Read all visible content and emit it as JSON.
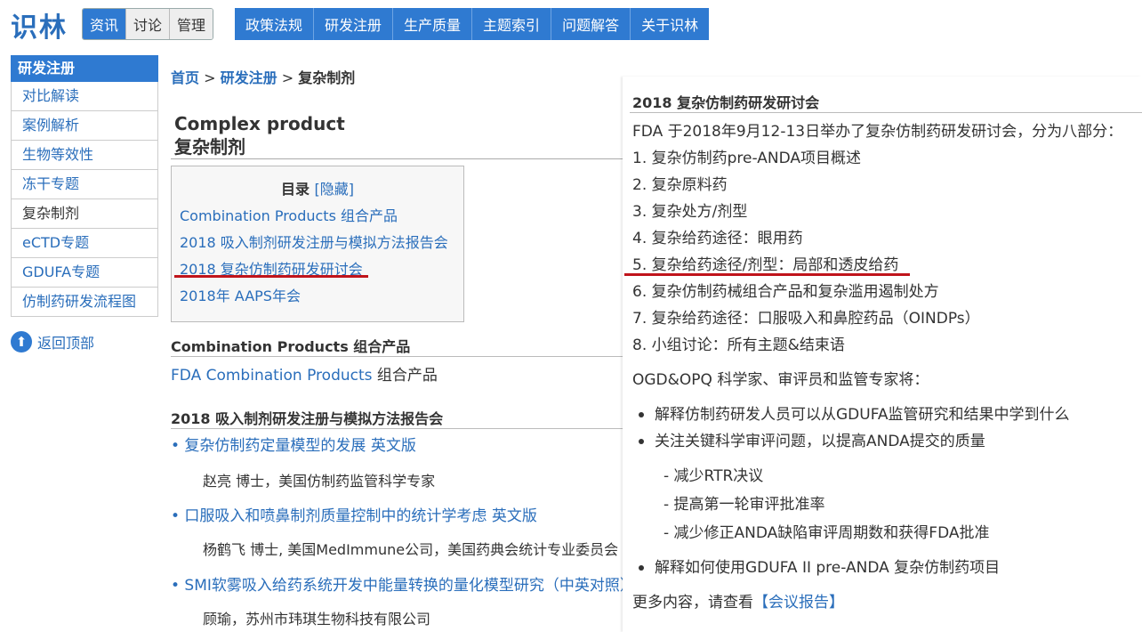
{
  "header": {
    "logo": "识林",
    "segments": [
      "资讯",
      "讨论",
      "管理"
    ],
    "nav": [
      "政策法规",
      "研发注册",
      "生产质量",
      "主题索引",
      "问题解答",
      "关于识林"
    ]
  },
  "sidebar": {
    "heading": "研发注册",
    "items": [
      "对比解读",
      "案例解析",
      "生物等效性",
      "冻干专题",
      "复杂制剂",
      "eCTD专题",
      "GDUFA专题",
      "仿制药研发流程图"
    ],
    "back_to_top": "返回顶部"
  },
  "breadcrumb": {
    "home": "首页",
    "sep": ">",
    "section": "研发注册",
    "current": "复杂制剂"
  },
  "page": {
    "title_en": "Complex product",
    "title_cn": "复杂制剂"
  },
  "toc": {
    "heading": "目录",
    "hide": "[隐藏]",
    "items": [
      "Combination Products 组合产品",
      "2018 吸入制剂研发注册与模拟方法报告会",
      "2018 复杂仿制药研发研讨会",
      "2018年 AAPS年会"
    ]
  },
  "combination": {
    "heading": "Combination Products 组合产品",
    "link": "FDA Combination Products",
    "link_suffix": " 组合产品"
  },
  "inhalation": {
    "heading": "2018 吸入制剂研发注册与模拟方法报告会",
    "entries": [
      {
        "title": "• 复杂仿制药定量模型的发展",
        "extra": "英文版",
        "author": "赵亮 博士，美国仿制药监管科学专家"
      },
      {
        "title": "• 口服吸入和喷鼻制剂质量控制中的统计学考虑",
        "extra": "英文版",
        "author": "杨鹤飞 博士, 美国MedImmune公司，美国药典会统计专业委员会"
      },
      {
        "title": "• SMI软雾吸入给药系统开发中能量转换的量化模型研究（中英对照）",
        "extra": "",
        "author": "顾瑜，苏州市玮琪生物科技有限公司"
      }
    ]
  },
  "workshop": {
    "heading": "2018 复杂仿制药研发研讨会",
    "intro": "FDA 于2018年9月12-13日举办了复杂仿制药研发研讨会，分为八部分：",
    "parts": [
      "1. 复杂仿制药pre-ANDA项目概述",
      "2. 复杂原料药",
      "3. 复杂处方/剂型",
      "4. 复杂给药途径：眼用药",
      "5. 复杂给药途径/剂型：局部和透皮给药",
      "6. 复杂仿制药械组合产品和复杂滥用遏制处方",
      "7. 复杂给药途径：口服吸入和鼻腔药品（OINDPs）",
      "8. 小组讨论：所有主题&结束语"
    ],
    "experts": "OGD&OPQ 科学家、审评员和监管专家将：",
    "bullets": [
      "解释仿制药研发人员可以从GDUFA监管研究和结果中学到什么",
      "关注关键科学审评问题，以提高ANDA提交的质量",
      "解释如何使用GDUFA II pre-ANDA 复杂仿制药项目"
    ],
    "subitems": [
      "- 减少RTR决议",
      "- 提高第一轮审评批准率",
      "- 减少修正ANDA缺陷审评周期数和获得FDA批准"
    ],
    "more": "更多内容，请查看",
    "more_link": "【会议报告】"
  }
}
